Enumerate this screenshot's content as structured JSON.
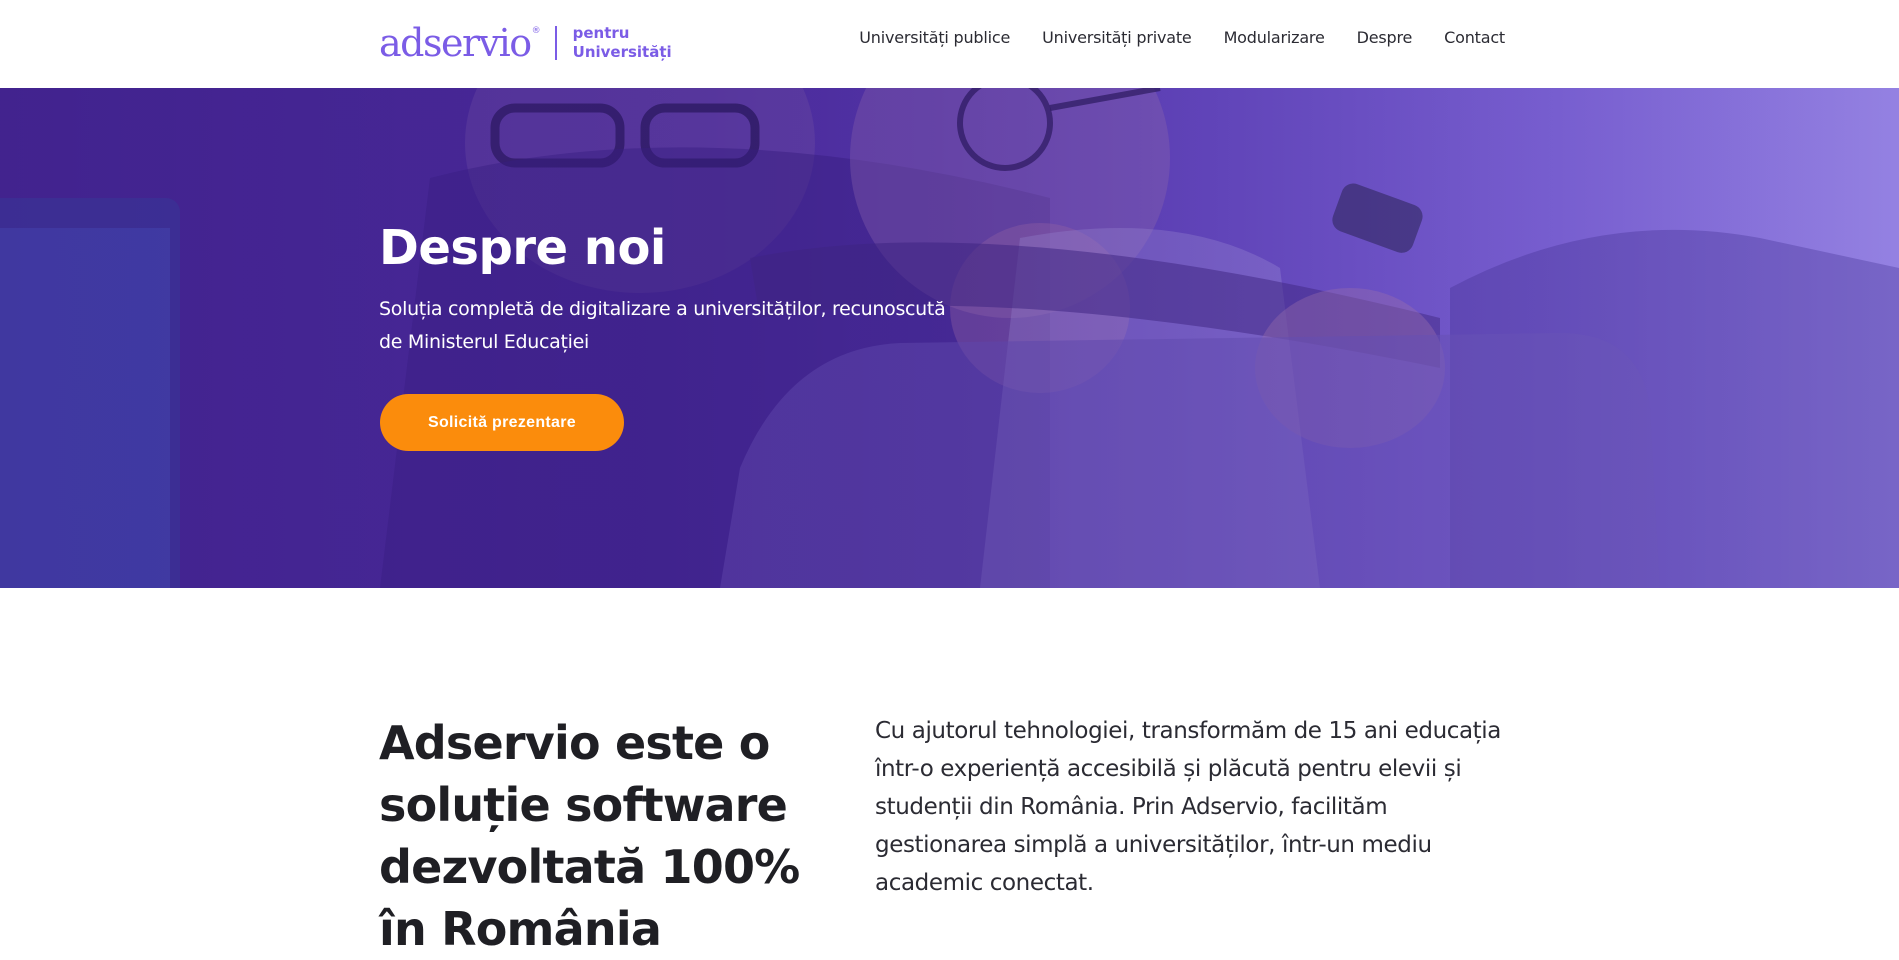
{
  "header": {
    "logo_word": "adservio",
    "logo_reg": "®",
    "logo_tag_line1": "pentru",
    "logo_tag_line2": "Universități",
    "nav": [
      {
        "label": "Universități publice"
      },
      {
        "label": "Universități private"
      },
      {
        "label": "Modularizare"
      },
      {
        "label": "Despre"
      },
      {
        "label": "Contact"
      }
    ]
  },
  "hero": {
    "title": "Despre noi",
    "subtitle": "Soluția completă de digitalizare a universităților, recunoscută de Ministerul Educației",
    "cta_label": "Solicită prezentare"
  },
  "intro": {
    "heading": "Adservio este o soluție software dezvoltată 100% în România",
    "text": "Cu ajutorul tehnologiei, transformăm de 15 ani educația într-o experiență accesibilă și plăcută pentru elevii și studenții din România. Prin Adservio, facilităm gestionarea simplă a universităților, într-un mediu academic conectat."
  },
  "colors": {
    "brand": "#7b5ce6",
    "hero_purple": "#4a2a9a",
    "cta_orange": "#fb8c0c"
  }
}
